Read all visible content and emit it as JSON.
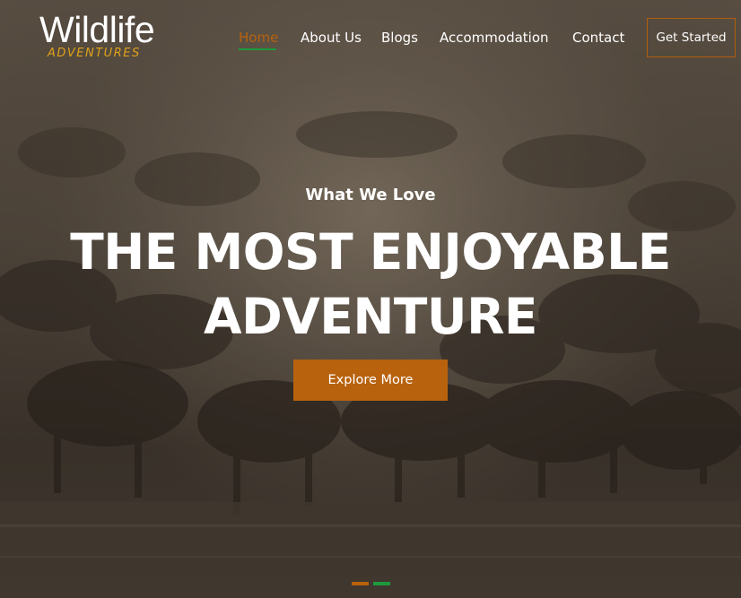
{
  "brand": {
    "title": "Wildlife",
    "subtitle": "ADVENTURES"
  },
  "nav": {
    "items": [
      {
        "label": "Home",
        "active": true
      },
      {
        "label": "About Us",
        "active": false
      },
      {
        "label": "Blogs",
        "active": false
      },
      {
        "label": "Accommodation",
        "active": false
      },
      {
        "label": "Contact",
        "active": false
      }
    ],
    "cta_label": "Get Started"
  },
  "hero": {
    "eyebrow": "What We Love",
    "headline_line1": "THE MOST ENJOYABLE",
    "headline_line2": "ADVENTURE",
    "button_label": "Explore More",
    "background_icon": "wildebeest-herd-photo"
  },
  "slider": {
    "slide_count": 2,
    "active_index": 0
  },
  "colors": {
    "accent": "#b8620e",
    "nav_underline": "#1e9a3c",
    "logo_sub": "#e0a21a",
    "dot_active": "#b8620e",
    "dot_inactive": "#1e9a3c"
  }
}
